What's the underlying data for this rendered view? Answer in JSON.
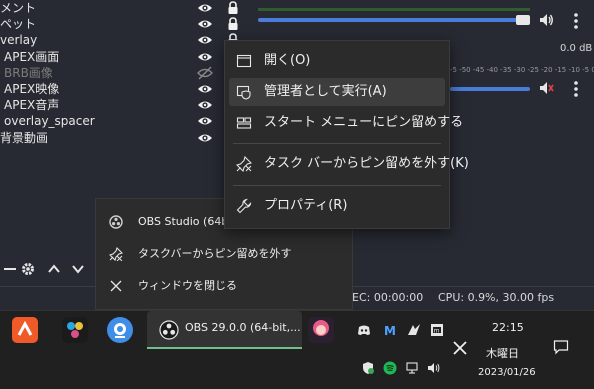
{
  "sources": {
    "items": [
      {
        "label": "メント",
        "visible": true,
        "locked": true,
        "indent": false
      },
      {
        "label": "ペット",
        "visible": true,
        "locked": true,
        "indent": false
      },
      {
        "label": "verlay",
        "visible": true,
        "locked": true,
        "indent": false
      },
      {
        "label": "APEX画面",
        "visible": true,
        "locked": true,
        "indent": true
      },
      {
        "label": "BRB画像",
        "visible": false,
        "locked": true,
        "indent": true
      },
      {
        "label": "APEX映像",
        "visible": true,
        "locked": false,
        "indent": true
      },
      {
        "label": "APEX音声",
        "visible": true,
        "locked": false,
        "indent": true
      },
      {
        "label": "overlay_spacer",
        "visible": true,
        "locked": false,
        "indent": true
      },
      {
        "label": "背景動画",
        "visible": true,
        "locked": false,
        "indent": false
      }
    ]
  },
  "mixer": {
    "db_label": "0.0 dB",
    "scale_text": "-5 -50 -45 -40 -35 -30 -25 -20 -15 -10 -5 0"
  },
  "status": {
    "rec": "EC: 00:00:00",
    "cpu": "CPU: 0.9%, 30.00 fps"
  },
  "context_menu": {
    "items": [
      {
        "label": "開く(O)",
        "icon": "window-icon",
        "highlighted": false
      },
      {
        "label": "管理者として実行(A)",
        "icon": "admin-shield-icon",
        "highlighted": true
      },
      {
        "label": "スタート メニューにピン留めする",
        "icon": "start-pin-icon",
        "highlighted": false
      },
      {
        "label": "タスク バーからピン留めを外す(K)",
        "icon": "unpin-icon",
        "highlighted": false
      },
      {
        "label": "プロパティ(R)",
        "icon": "wrench-icon",
        "highlighted": false
      }
    ]
  },
  "jump_list": {
    "app_title": "OBS Studio (64b",
    "unpin_label": "タスクバーからピン留めを外す",
    "close_label": "ウィンドウを閉じる"
  },
  "taskbar": {
    "obs_label": "OBS 29.0.0 (64-bit,...",
    "accent": "#6fc08a"
  },
  "clock": {
    "time": "22:15",
    "day": "木曜日",
    "date": "2023/01/26"
  }
}
